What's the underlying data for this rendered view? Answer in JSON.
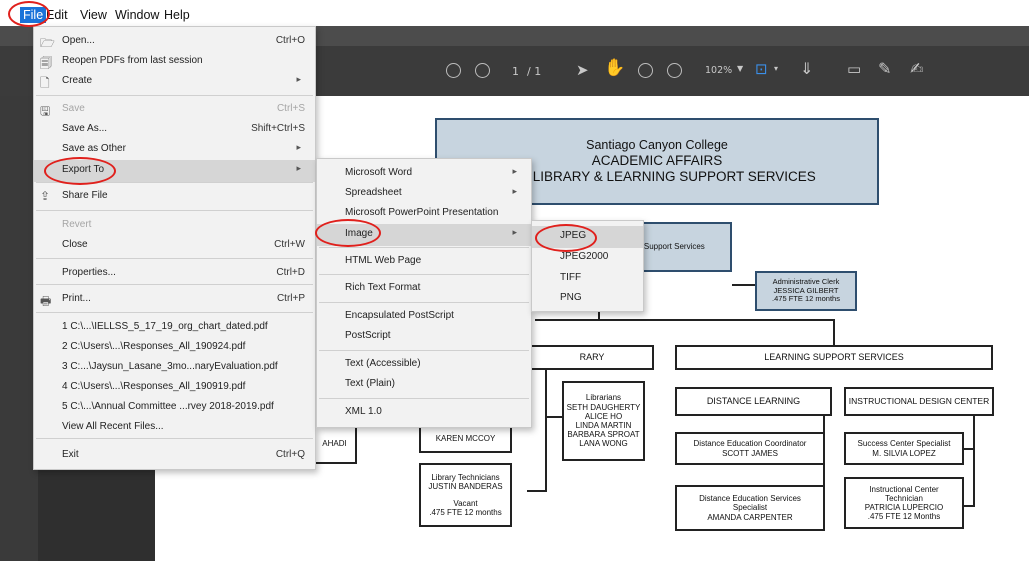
{
  "menubar": {
    "file": "File",
    "edit": "Edit",
    "view": "View",
    "window": "Window",
    "help": "Help"
  },
  "toolbar": {
    "page_current": "1",
    "page_sep": "/ 1",
    "zoom": "102%"
  },
  "file_menu": [
    {
      "label": "Open...",
      "shortcut": "Ctrl+O",
      "icon": "folder-open-icon"
    },
    {
      "label": "Reopen PDFs from last session",
      "shortcut": "",
      "icon": "reopen-icon"
    },
    {
      "label": "Create",
      "shortcut": "",
      "icon": "create-icon",
      "submenu": true
    },
    {
      "label": "Save",
      "shortcut": "Ctrl+S",
      "icon": "save-icon",
      "disabled": true
    },
    {
      "label": "Save As...",
      "shortcut": "Shift+Ctrl+S"
    },
    {
      "label": "Save as Other",
      "shortcut": "",
      "submenu": true
    },
    {
      "label": "Export To",
      "shortcut": "",
      "submenu": true,
      "highlight": true
    },
    {
      "label": "Share File",
      "shortcut": "",
      "icon": "share-icon"
    },
    {
      "label": "Revert",
      "shortcut": "",
      "disabled": true
    },
    {
      "label": "Close",
      "shortcut": "Ctrl+W"
    },
    {
      "label": "Properties...",
      "shortcut": "Ctrl+D"
    },
    {
      "label": "Print...",
      "shortcut": "Ctrl+P",
      "icon": "print-icon"
    },
    {
      "label": "1 C:\\...\\IELLSS_5_17_19_org_chart_dated.pdf",
      "shortcut": ""
    },
    {
      "label": "2 C:\\Users\\...\\Responses_All_190924.pdf",
      "shortcut": ""
    },
    {
      "label": "3 C:...\\Jaysun_Lasane_3mo...naryEvaluation.pdf",
      "shortcut": ""
    },
    {
      "label": "4 C:\\Users\\...\\Responses_All_190919.pdf",
      "shortcut": ""
    },
    {
      "label": "5 C:\\...\\Annual Committee ...rvey 2018-2019.pdf",
      "shortcut": ""
    },
    {
      "label": "View All Recent Files...",
      "shortcut": ""
    },
    {
      "label": "Exit",
      "shortcut": "Ctrl+Q"
    }
  ],
  "export_menu": [
    {
      "label": "Microsoft Word",
      "submenu": true
    },
    {
      "label": "Spreadsheet",
      "submenu": true
    },
    {
      "label": "Microsoft PowerPoint Presentation"
    },
    {
      "label": "Image",
      "submenu": true,
      "highlight": true
    },
    {
      "label": "HTML Web Page"
    },
    {
      "label": "Rich Text Format"
    },
    {
      "label": "Encapsulated PostScript"
    },
    {
      "label": "PostScript"
    },
    {
      "label": "Text (Accessible)"
    },
    {
      "label": "Text (Plain)"
    },
    {
      "label": "XML 1.0"
    }
  ],
  "image_menu": [
    {
      "label": "JPEG",
      "highlight": true
    },
    {
      "label": "JPEG2000"
    },
    {
      "label": "TIFF"
    },
    {
      "label": "PNG"
    }
  ],
  "org": {
    "title1": "Santiago Canyon College",
    "title2": "ACADEMIC AFFAIRS",
    "title3": "ESS, LIBRARY & LEARNING SUPPORT SERVICES",
    "support_box": "g Support Services",
    "admin_clerk": [
      "Administrative Clerk",
      "JESSICA GILBERT",
      ".475 FTE 12 months"
    ],
    "library": "RARY",
    "learning_support": "LEARNING SUPPORT SERVICES",
    "librarians": [
      "Librarians",
      "SETH DAUGHERTY",
      "ALICE HO",
      "LINDA MARTIN",
      "BARBARA SPROAT",
      "LANA WONG"
    ],
    "distance_learning": "DISTANCE LEARNING",
    "instructional_design": "INSTRUCTIONAL DESIGN CENTER",
    "ahadi": "AHADI",
    "karen": "KAREN MCCOY",
    "de_coordinator": [
      "Distance Education Coordinator",
      "SCOTT JAMES"
    ],
    "success_center": [
      "Success Center Specialist",
      "M. SILVIA LOPEZ"
    ],
    "lib_tech": [
      "Library Technicians",
      "JUSTIN BANDERAS",
      "",
      "Vacant",
      ".475 FTE 12 months"
    ],
    "de_services": [
      "Distance Education Services",
      "Specialist",
      "AMANDA CARPENTER"
    ],
    "ic_tech": [
      "Instructional Center",
      "Technician",
      "PATRICIA LUPERCIO",
      ".475 FTE 12 Months"
    ]
  }
}
